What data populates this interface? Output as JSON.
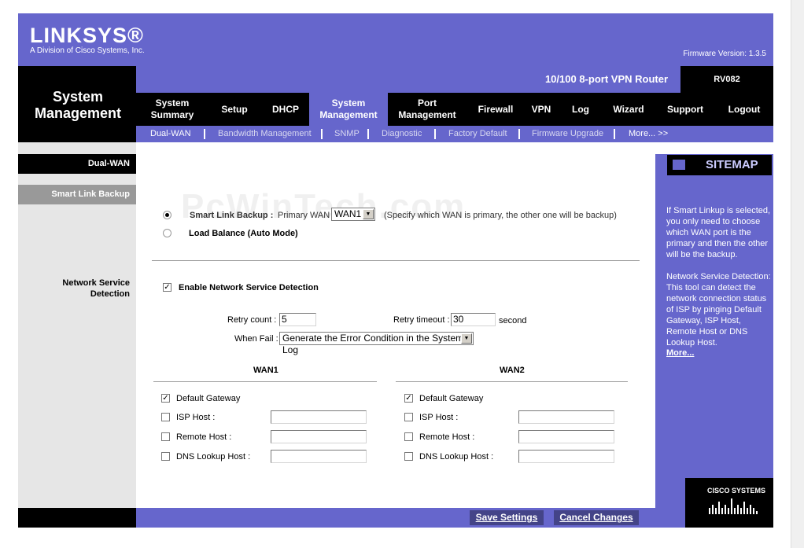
{
  "brand": {
    "logo": "LINKSYS®",
    "subtitle": "A Division of Cisco Systems, Inc.",
    "firmware": "Firmware Version: 1.3.5",
    "product_name": "10/100 8-port VPN Router",
    "model": "RV082"
  },
  "section_title": [
    "System",
    "Management"
  ],
  "tabs": [
    {
      "label1": "System",
      "label2": "Summary"
    },
    {
      "label1": "Setup",
      "label2": ""
    },
    {
      "label1": "DHCP",
      "label2": ""
    },
    {
      "label1": "System",
      "label2": "Management"
    },
    {
      "label1": "Port",
      "label2": "Management"
    },
    {
      "label1": "Firewall",
      "label2": ""
    },
    {
      "label1": "VPN",
      "label2": ""
    },
    {
      "label1": "Log",
      "label2": ""
    },
    {
      "label1": "Wizard",
      "label2": ""
    },
    {
      "label1": "Support",
      "label2": ""
    },
    {
      "label1": "Logout",
      "label2": ""
    }
  ],
  "subtabs": [
    "Dual-WAN",
    "Bandwidth Management",
    "SNMP",
    "Diagnostic",
    "Factory Default",
    "Firmware Upgrade",
    "More...  >>"
  ],
  "left": {
    "header": "Dual-WAN",
    "selected": "Smart Link Backup",
    "nsd": [
      "Network Service",
      "Detection"
    ]
  },
  "watermark": "PcWinTech.com",
  "mode": {
    "smart_label": "Smart Link Backup :",
    "primary_label": "Primary WAN",
    "primary_value": "WAN1",
    "primary_hint": "(Specify which WAN is primary, the other one will be backup)",
    "load_balance_label": "Load Balance (Auto Mode)"
  },
  "nsd": {
    "enable_label": "Enable Network Service Detection",
    "check": "✓",
    "retry_count_label": "Retry count :",
    "retry_count_value": "5",
    "retry_timeout_label": "Retry timeout :",
    "retry_timeout_value": "30",
    "retry_timeout_unit": "second",
    "when_fail_label": "When Fail :",
    "when_fail_value": "Generate the Error Condition in the System Log"
  },
  "wan1": {
    "title": "WAN1",
    "default_gateway": "Default Gateway",
    "isp_host": "ISP Host :",
    "remote_host": "Remote Host :",
    "dns_host": "DNS Lookup Host :"
  },
  "wan2": {
    "title": "WAN2",
    "default_gateway": "Default Gateway",
    "isp_host": "ISP Host :",
    "remote_host": "Remote Host :",
    "dns_host": "DNS Lookup Host :"
  },
  "sitemap": {
    "label": "SITEMAP",
    "help1": "If Smart Linkup is selected, you only need to choose which WAN port is the primary and then the other will be the backup.",
    "help2": "Network Service Detection: This tool can detect the network connection status of ISP by pinging Default Gateway, ISP Host, Remote Host or DNS Lookup Host.",
    "more": "More..."
  },
  "cisco": "CISCO SYSTEMS",
  "footer": {
    "save": "Save Settings",
    "cancel": "Cancel Changes"
  },
  "colors": {
    "brand_purple": "#6666cc",
    "black": "#000000",
    "left_gray": "#e6e6e6"
  }
}
